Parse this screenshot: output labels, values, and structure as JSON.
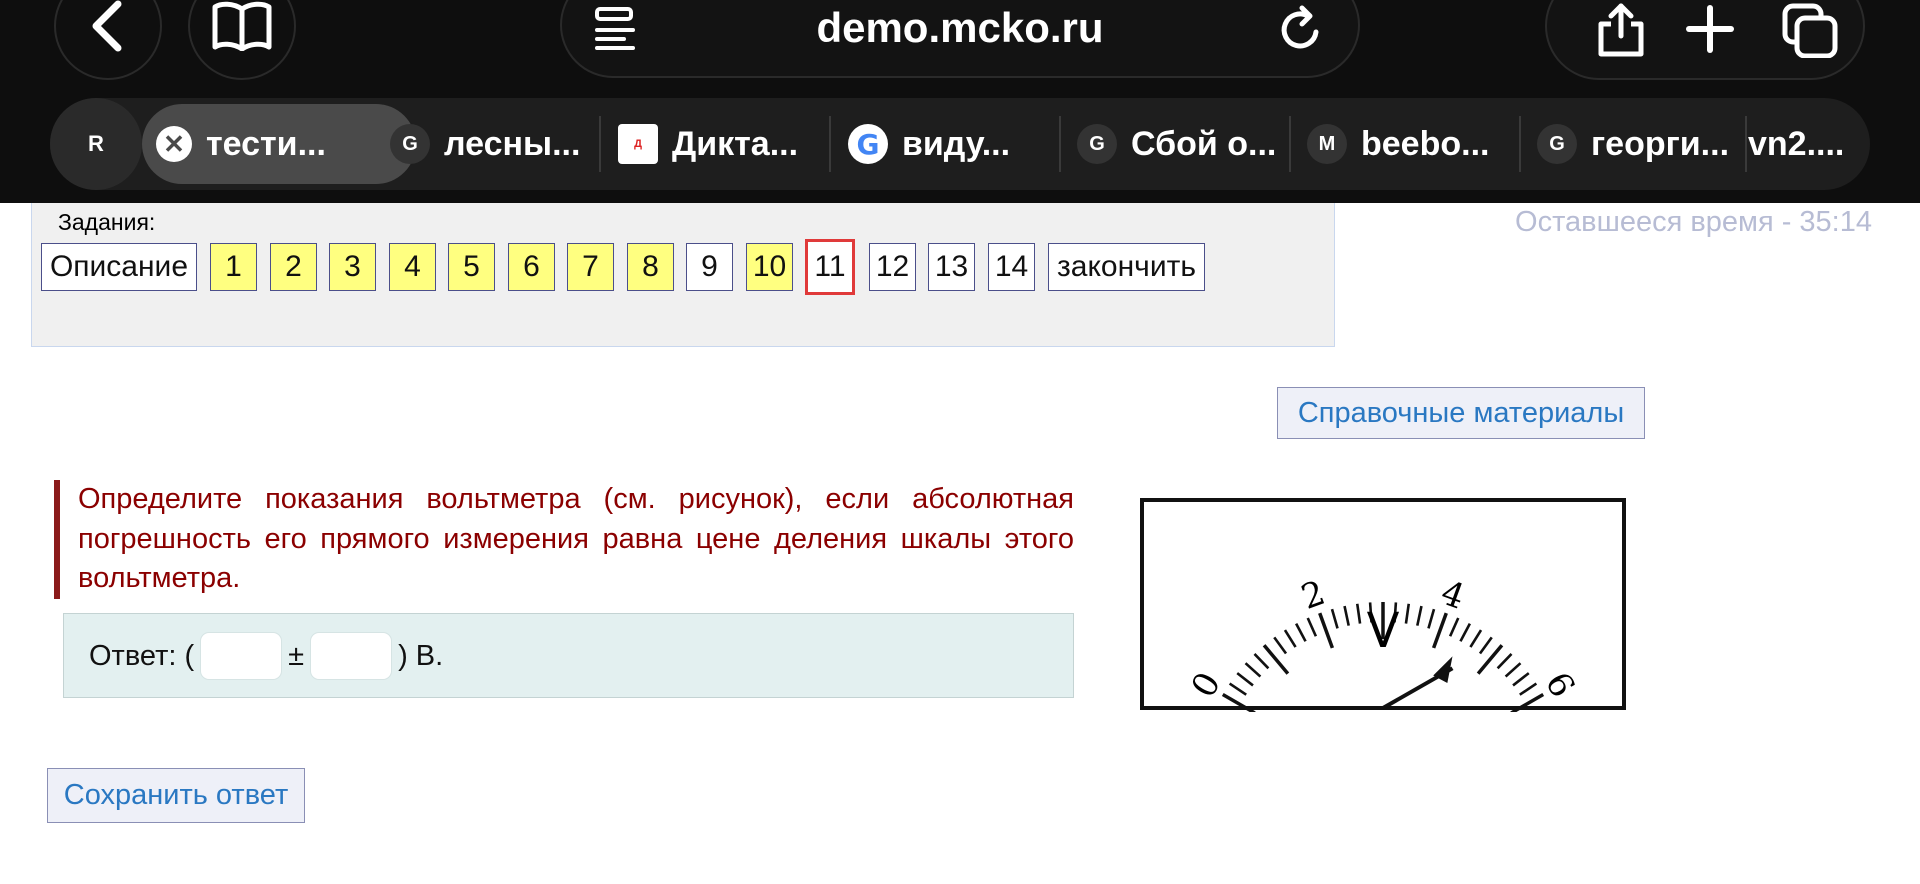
{
  "browser": {
    "address": "demo.mcko.ru",
    "profile_initial": "R",
    "tabs": [
      {
        "label": "тести...",
        "favicon": "close-x",
        "active": true
      },
      {
        "label": "лесны...",
        "favicon": "G"
      },
      {
        "label": "Дикта...",
        "favicon": "diktant-logo"
      },
      {
        "label": "виду...",
        "favicon": "google-logo"
      },
      {
        "label": "Сбой о...",
        "favicon": "G"
      },
      {
        "label": "beebo...",
        "favicon": "M"
      },
      {
        "label": "георги...",
        "favicon": "G"
      },
      {
        "label": "vn2....",
        "favicon": ""
      }
    ]
  },
  "nav": {
    "label": "Задания:",
    "description_label": "Описание",
    "tasks": [
      {
        "label": "1",
        "state": "done"
      },
      {
        "label": "2",
        "state": "done"
      },
      {
        "label": "3",
        "state": "done"
      },
      {
        "label": "4",
        "state": "done"
      },
      {
        "label": "5",
        "state": "done"
      },
      {
        "label": "6",
        "state": "done"
      },
      {
        "label": "7",
        "state": "done"
      },
      {
        "label": "8",
        "state": "done"
      },
      {
        "label": "9",
        "state": "todo"
      },
      {
        "label": "10",
        "state": "done"
      },
      {
        "label": "11",
        "state": "current"
      },
      {
        "label": "12",
        "state": "todo"
      },
      {
        "label": "13",
        "state": "todo"
      },
      {
        "label": "14",
        "state": "todo"
      }
    ],
    "finish_label": "закончить"
  },
  "timer": "Оставшееся время - 35:14",
  "reference_label": "Справочные материалы",
  "question": "Определите показания вольтметра (см. рисунок), если абсолютная погрешность его прямого измерения равна цене деления шкалы этого вольтметра.",
  "answer": {
    "prefix": "Ответ: (",
    "plus_minus": "±",
    "suffix": ") В.",
    "value": "",
    "error": ""
  },
  "meter": {
    "scale_labels": [
      "0",
      "2",
      "4",
      "6"
    ],
    "unit": "V",
    "reading": 4.4,
    "scale_max": 6,
    "divisions": 30
  },
  "save_label": "Сохранить ответ",
  "colors": {
    "done_task": "#ffff80",
    "current_task_border": "#e03a3a",
    "question_text": "#8b0000",
    "link_text": "#2a78c2"
  }
}
